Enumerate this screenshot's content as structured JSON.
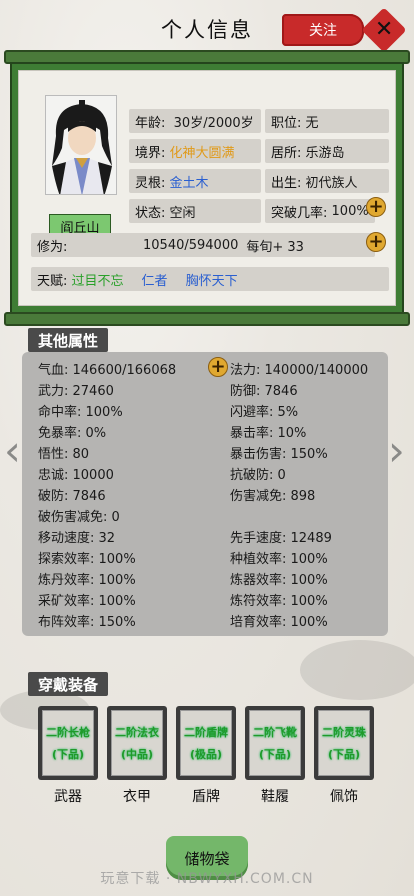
{
  "header": {
    "title": "个人信息",
    "follow_label": "关注",
    "close_icon": "close-icon"
  },
  "character": {
    "name": "阎丘山",
    "age_label": "年龄:",
    "age_value": "30岁/2000岁",
    "position_label": "职位:",
    "position_value": "无",
    "realm_label": "境界:",
    "realm_value": "化神大圆满",
    "residence_label": "居所:",
    "residence_value": "乐游岛",
    "root_label": "灵根:",
    "root_value": "金土木",
    "birth_label": "出生:",
    "birth_value": "初代族人",
    "status_label": "状态:",
    "status_value": "空闲",
    "breakthrough_label": "突破几率:",
    "breakthrough_value": "100%",
    "cultivation_label": "修为:",
    "cultivation_value": "10540/594000",
    "cultivation_rate": "每旬+ 33",
    "talent_label": "天赋:",
    "talents": [
      "过目不忘",
      "仁者",
      "胸怀天下"
    ]
  },
  "attributes": {
    "section_title": "其他属性",
    "left": [
      "气血: 146600/166068",
      "武力: 27460",
      "命中率: 100%",
      "免暴率: 0%",
      "悟性: 80",
      "忠诚: 10000",
      "破防: 7846",
      "破伤害减免: 0",
      "移动速度: 32",
      "探索效率: 100%",
      "炼丹效率: 100%",
      "采矿效率: 100%",
      "布阵效率: 150%"
    ],
    "right": [
      "法力: 140000/140000",
      "防御: 7846",
      "闪避率: 5%",
      "暴击率: 10%",
      "暴击伤害: 150%",
      "抗破防: 0",
      "伤害减免: 898",
      "",
      "先手速度: 12489",
      "种植效率: 100%",
      "炼器效率: 100%",
      "炼符效率: 100%",
      "培育效率: 100%"
    ]
  },
  "equipment": {
    "section_title": "穿戴装备",
    "slots": [
      {
        "name": "二阶长枪",
        "grade": "(下品)",
        "label": "武器"
      },
      {
        "name": "二阶法衣",
        "grade": "(中品)",
        "label": "衣甲"
      },
      {
        "name": "二阶盾牌",
        "grade": "(极品)",
        "label": "盾牌"
      },
      {
        "name": "二阶飞靴",
        "grade": "(下品)",
        "label": "鞋履"
      },
      {
        "name": "二阶灵珠",
        "grade": "(下品)",
        "label": "佩饰"
      }
    ]
  },
  "footer": {
    "storage_label": "储物袋",
    "watermark": "玩意下载 · NBWYXH.COM.CN"
  },
  "colors": {
    "realm": "#e09a1a",
    "root": "#2a5fd0",
    "talent_green": "#2aa02a",
    "talent_blue": "#2a5fd0",
    "accent_red": "#c82a2a",
    "scroll_green": "#3e7d34"
  }
}
